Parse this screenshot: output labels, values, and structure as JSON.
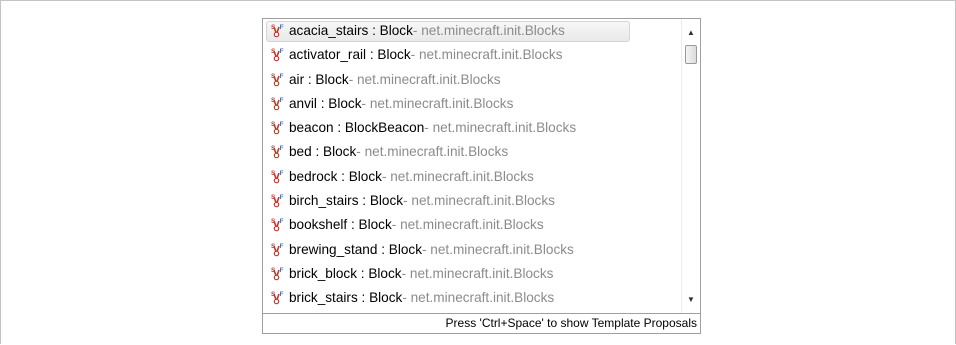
{
  "proposals": {
    "selected_index": 0,
    "items": [
      {
        "name": "acacia_stairs : Block",
        "qualifier": " - net.minecraft.init.Blocks",
        "icon": "static-final-field-icon"
      },
      {
        "name": "activator_rail : Block",
        "qualifier": " - net.minecraft.init.Blocks",
        "icon": "static-final-field-icon"
      },
      {
        "name": "air : Block",
        "qualifier": " - net.minecraft.init.Blocks",
        "icon": "static-final-field-icon"
      },
      {
        "name": "anvil : Block",
        "qualifier": " - net.minecraft.init.Blocks",
        "icon": "static-final-field-icon"
      },
      {
        "name": "beacon : BlockBeacon",
        "qualifier": " - net.minecraft.init.Blocks",
        "icon": "static-final-field-icon"
      },
      {
        "name": "bed : Block",
        "qualifier": " - net.minecraft.init.Blocks",
        "icon": "static-final-field-icon"
      },
      {
        "name": "bedrock : Block",
        "qualifier": " - net.minecraft.init.Blocks",
        "icon": "static-final-field-icon"
      },
      {
        "name": "birch_stairs : Block",
        "qualifier": " - net.minecraft.init.Blocks",
        "icon": "static-final-field-icon"
      },
      {
        "name": "bookshelf : Block",
        "qualifier": " - net.minecraft.init.Blocks",
        "icon": "static-final-field-icon"
      },
      {
        "name": "brewing_stand : Block",
        "qualifier": " - net.minecraft.init.Blocks",
        "icon": "static-final-field-icon"
      },
      {
        "name": "brick_block : Block",
        "qualifier": " - net.minecraft.init.Blocks",
        "icon": "static-final-field-icon"
      },
      {
        "name": "brick_stairs : Block",
        "qualifier": " - net.minecraft.init.Blocks",
        "icon": "static-final-field-icon"
      }
    ]
  },
  "scrollbar": {
    "up_arrow": "▲",
    "down_arrow": "▼"
  },
  "status_bar": {
    "text": "Press 'Ctrl+Space' to show Template Proposals"
  },
  "colors": {
    "qualifier": "#8b8b8b",
    "icon_red": "#c0392b",
    "icon_blue": "#3a6fc4"
  }
}
